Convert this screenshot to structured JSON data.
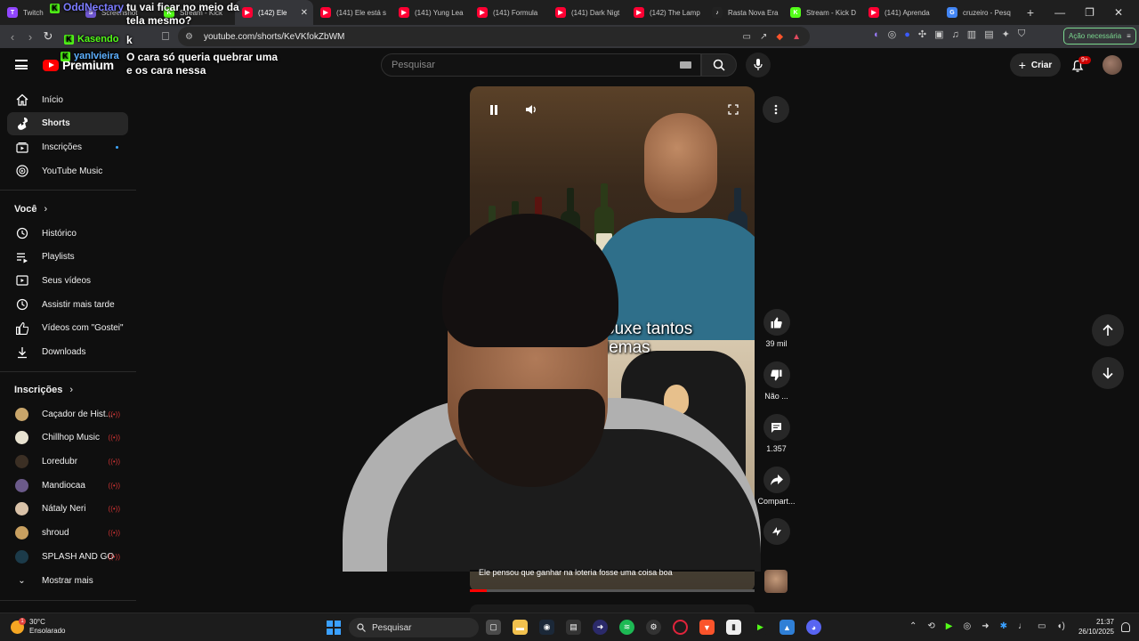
{
  "browser": {
    "tabs": [
      {
        "label": "Twitch",
        "color": "#9146ff",
        "glyph": "T"
      },
      {
        "label": "Screenshot",
        "color": "#6e56cf",
        "glyph": "S"
      },
      {
        "label": "Stream - Kick",
        "color": "#53fc18",
        "glyph": "K"
      },
      {
        "label": "(142) Ele",
        "color": "#ff0033",
        "glyph": "▶",
        "active": true
      },
      {
        "label": "(141) Ele está s",
        "color": "#ff0033",
        "glyph": "▶"
      },
      {
        "label": "(141) Yung Lea",
        "color": "#ff0033",
        "glyph": "▶"
      },
      {
        "label": "(141) Formula",
        "color": "#ff0033",
        "glyph": "▶"
      },
      {
        "label": "(141) Dark Nigt",
        "color": "#ff0033",
        "glyph": "▶"
      },
      {
        "label": "(142) The Lamp",
        "color": "#ff0033",
        "glyph": "▶"
      },
      {
        "label": "Rasta Nova Era",
        "color": "#222222",
        "glyph": "♪"
      },
      {
        "label": "Stream - Kick D",
        "color": "#53fc18",
        "glyph": "K"
      },
      {
        "label": "(141) Aprenda",
        "color": "#ff0033",
        "glyph": "▶"
      },
      {
        "label": "cruzeiro - Pesq",
        "color": "#4285f4",
        "glyph": "G"
      }
    ],
    "url": "youtube.com/shorts/KeVKfokZbWM",
    "action_button": "Ação necessária"
  },
  "youtube": {
    "logo_text": "Premium",
    "search_placeholder": "Pesquisar",
    "create_label": "Criar",
    "notif_badge": "9+"
  },
  "sidebar": {
    "main": [
      {
        "label": "Início",
        "icon": "home-icon"
      },
      {
        "label": "Shorts",
        "icon": "shorts-icon",
        "active": true
      },
      {
        "label": "Inscrições",
        "icon": "subscriptions-icon",
        "dot": true
      },
      {
        "label": "YouTube Music",
        "icon": "music-icon"
      }
    ],
    "you_header": "Você",
    "you": [
      {
        "label": "Histórico",
        "icon": "history-icon"
      },
      {
        "label": "Playlists",
        "icon": "playlists-icon"
      },
      {
        "label": "Seus vídeos",
        "icon": "your-videos-icon"
      },
      {
        "label": "Assistir mais tarde",
        "icon": "watch-later-icon"
      },
      {
        "label": "Vídeos com \"Gostei\"",
        "icon": "liked-icon"
      },
      {
        "label": "Downloads",
        "icon": "download-icon"
      }
    ],
    "subs_header": "Inscrições",
    "subs": [
      {
        "label": "Caçador de Hist...",
        "color": "#c9a66b"
      },
      {
        "label": "Chillhop Music",
        "color": "#e8e2d0"
      },
      {
        "label": "Loredubr",
        "color": "#3b2f24"
      },
      {
        "label": "Mandiocaa",
        "color": "#6b5a8a"
      },
      {
        "label": "Nátaly Neri",
        "color": "#d9c2a8"
      },
      {
        "label": "shroud",
        "color": "#c8a060"
      },
      {
        "label": "SPLASH AND GO",
        "color": "#1c3b4a"
      }
    ],
    "show_more": "Mostrar mais"
  },
  "chat": {
    "line1_name": "OddNectary",
    "line1_text": "tu vai ficar no meio da tela mesmo?",
    "line2_name": "Kasendo",
    "line2_text": "k",
    "line3_name": "yanlvieira",
    "line3_text": "O cara só queria quebrar uma e os cara nessa"
  },
  "short": {
    "caption": "ouxe tantos\nlemas",
    "title": "Ele pensou que ganhar na loteria fosse uma coisa boa",
    "progress": 0.06,
    "likes": "39 mil",
    "dislike_label": "Não ...",
    "comments": "1.357",
    "share_label": "Compart..."
  },
  "taskbar": {
    "temp": "30°C",
    "weather": "Ensolarado",
    "weather_badge": "1",
    "search": "Pesquisar",
    "time": "21:37",
    "date": "26/10/2025"
  }
}
